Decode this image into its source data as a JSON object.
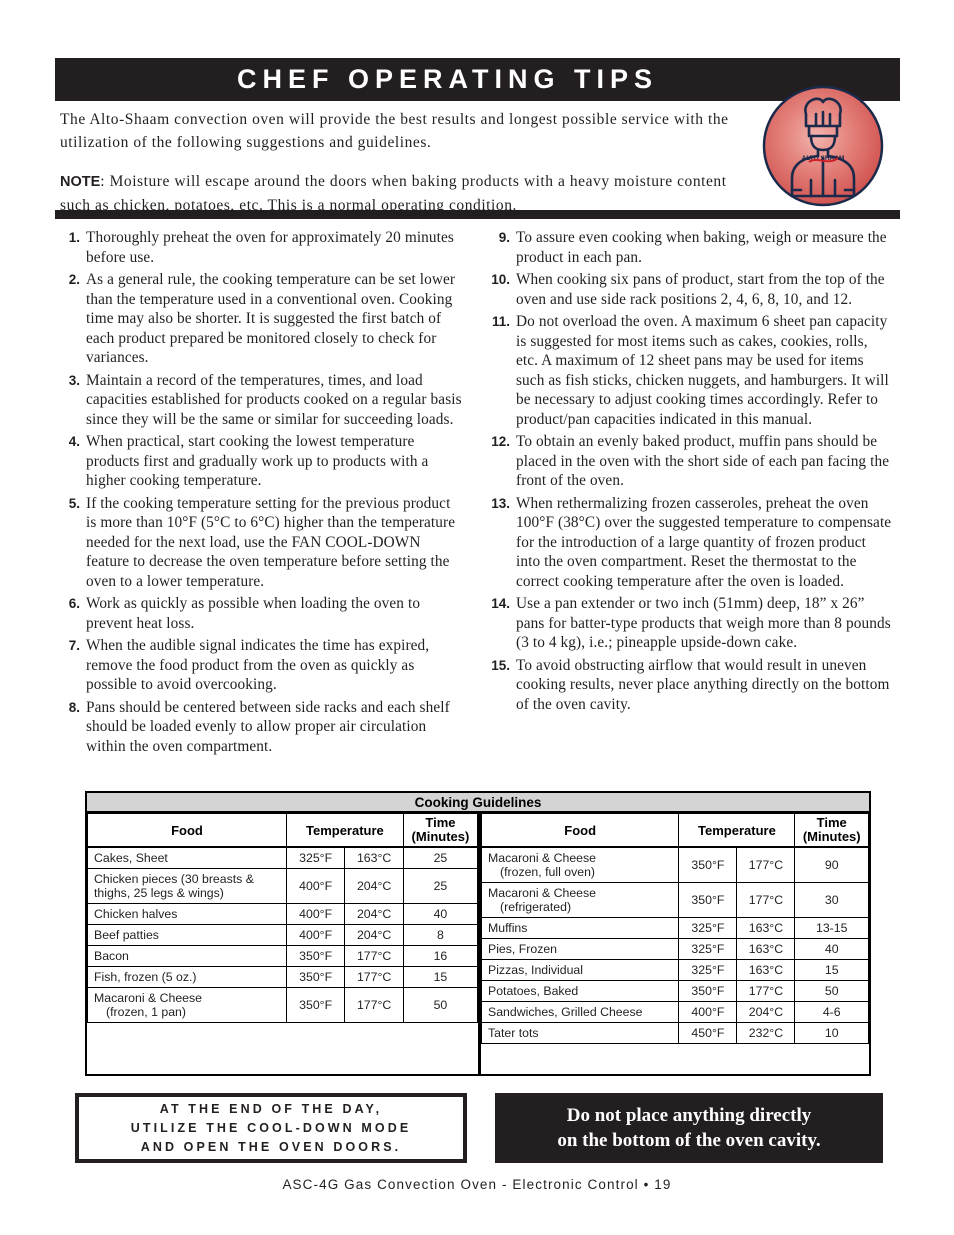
{
  "header": {
    "title": "CHEF OPERATING TIPS",
    "bar_color": "#231f20"
  },
  "intro": {
    "paragraph": "The Alto-Shaam convection oven will provide the best results and longest possible service with the utilization of the following suggestions and guidelines.",
    "note_label": "NOTE",
    "note_text": ":  Moisture will escape around the doors when baking products with a heavy moisture content such as chicken, potatoes, etc.  This is a normal operating condition."
  },
  "logo": {
    "name": "alto-shaam-chef-logo",
    "wordmark": "ALTO SHAAM",
    "circle_color": "#d9534f",
    "outline_color": "#1b2a4a"
  },
  "tips_left": [
    {
      "num": "1.",
      "text": "Thoroughly preheat the oven for approximately 20 minutes before use."
    },
    {
      "num": "2.",
      "text": "As a general rule, the cooking temperature can be set lower than the temperature used in a conventional oven.  Cooking time may also be shorter.  It is suggested the first batch of each product prepared be monitored closely to check for variances."
    },
    {
      "num": "3.",
      "text": "Maintain a record of the temperatures, times, and load capacities established for products cooked on a regular basis since they will be the same or similar for succeeding loads."
    },
    {
      "num": "4.",
      "text": "When practical, start cooking the lowest temperature products first and gradually work up to products with a higher cooking temperature."
    },
    {
      "num": "5.",
      "text": "If the cooking temperature setting for the previous product is more than 10°F (5°C to 6°C) higher than the temperature needed for the next load, use the FAN COOL-DOWN feature to decrease the oven temperature before setting the oven to a lower temperature."
    },
    {
      "num": "6.",
      "text": "Work as quickly as possible when loading the oven to prevent heat loss."
    },
    {
      "num": "7.",
      "text": "When the audible signal indicates the time has expired, remove the food product from the oven as quickly as possible to avoid overcooking."
    },
    {
      "num": "8.",
      "text": "Pans should be centered between side racks and each shelf should be loaded evenly to allow proper air circulation within the oven compartment."
    }
  ],
  "tips_right": [
    {
      "num": "9.",
      "text": "To assure even cooking when baking, weigh or measure the product in each pan."
    },
    {
      "num": "10.",
      "text": "When cooking six pans of product, start from the top of the oven and use side rack positions 2, 4, 6, 8, 10, and 12."
    },
    {
      "num": "11.",
      "text": "Do not overload the oven.  A maximum 6 sheet pan capacity is suggested for most items such as cakes, cookies, rolls, etc.  A maximum of 12 sheet pans may be used for items such as fish sticks, chicken nuggets, and hamburgers.  It will be necessary to adjust cooking times accordingly.  Refer to product/pan capacities indicated in this manual."
    },
    {
      "num": "12.",
      "text": "To obtain an evenly baked product, muffin pans should be placed in the oven with the short side of each pan facing the front of the oven."
    },
    {
      "num": "13.",
      "text": "When rethermalizing frozen casseroles, preheat the oven 100°F (38°C) over the suggested temperature to compensate for the introduction of a large quantity of frozen product into the oven compartment.  Reset the thermostat to the correct cooking temperature after the oven is loaded."
    },
    {
      "num": "14.",
      "text": "Use a pan extender or two inch (51mm) deep, 18” x 26” pans for batter-type products that weigh more than 8 pounds (3 to 4 kg), i.e.; pineapple upside-down cake."
    },
    {
      "num": "15.",
      "text": "To avoid obstructing airflow that would result in uneven cooking results, never place anything directly on the bottom of the oven cavity."
    }
  ],
  "table": {
    "title": "Cooking Guidelines",
    "headers": {
      "food": "Food",
      "temperature": "Temperature",
      "time_line1": "Time",
      "time_line2": "(Minutes)"
    },
    "rows_left": [
      {
        "food": "Cakes, Sheet",
        "food_sub": "",
        "f": "325°F",
        "c": "163°C",
        "time": "25"
      },
      {
        "food": "Chicken pieces (30 breasts & thighs, 25 legs & wings)",
        "food_sub": "",
        "f": "400°F",
        "c": "204°C",
        "time": "25"
      },
      {
        "food": "Chicken halves",
        "food_sub": "",
        "f": "400°F",
        "c": "204°C",
        "time": "40"
      },
      {
        "food": "Beef patties",
        "food_sub": "",
        "f": "400°F",
        "c": "204°C",
        "time": "8"
      },
      {
        "food": "Bacon",
        "food_sub": "",
        "f": "350°F",
        "c": "177°C",
        "time": "16"
      },
      {
        "food": "Fish, frozen (5 oz.)",
        "food_sub": "",
        "f": "350°F",
        "c": "177°C",
        "time": "15"
      },
      {
        "food": "Macaroni & Cheese",
        "food_sub": "(frozen, 1 pan)",
        "f": "350°F",
        "c": "177°C",
        "time": "50"
      }
    ],
    "rows_right": [
      {
        "food": "Macaroni & Cheese",
        "food_sub": "(frozen, full oven)",
        "f": "350°F",
        "c": "177°C",
        "time": "90"
      },
      {
        "food": "Macaroni & Cheese",
        "food_sub": "(refrigerated)",
        "f": "350°F",
        "c": "177°C",
        "time": "30"
      },
      {
        "food": "Muffins",
        "food_sub": "",
        "f": "325°F",
        "c": "163°C",
        "time": "13-15"
      },
      {
        "food": "Pies, Frozen",
        "food_sub": "",
        "f": "325°F",
        "c": "163°C",
        "time": "40"
      },
      {
        "food": "Pizzas, Individual",
        "food_sub": "",
        "f": "325°F",
        "c": "163°C",
        "time": "15"
      },
      {
        "food": "Potatoes, Baked",
        "food_sub": "",
        "f": "350°F",
        "c": "177°C",
        "time": "50"
      },
      {
        "food": "Sandwiches, Grilled Cheese",
        "food_sub": "",
        "f": "400°F",
        "c": "204°C",
        "time": "4-6"
      },
      {
        "food": "Tater tots",
        "food_sub": "",
        "f": "450°F",
        "c": "232°C",
        "time": "10"
      }
    ]
  },
  "callouts": {
    "outline_line1": "AT THE END OF THE DAY,",
    "outline_line2": "UTILIZE THE COOL-DOWN MODE",
    "outline_line3": "AND OPEN THE OVEN DOORS.",
    "solid_line1": "Do not place anything directly",
    "solid_line2": "on the bottom of the oven cavity."
  },
  "footer": {
    "text": "ASC-4G Gas Convection Oven - Electronic Control • 19"
  }
}
